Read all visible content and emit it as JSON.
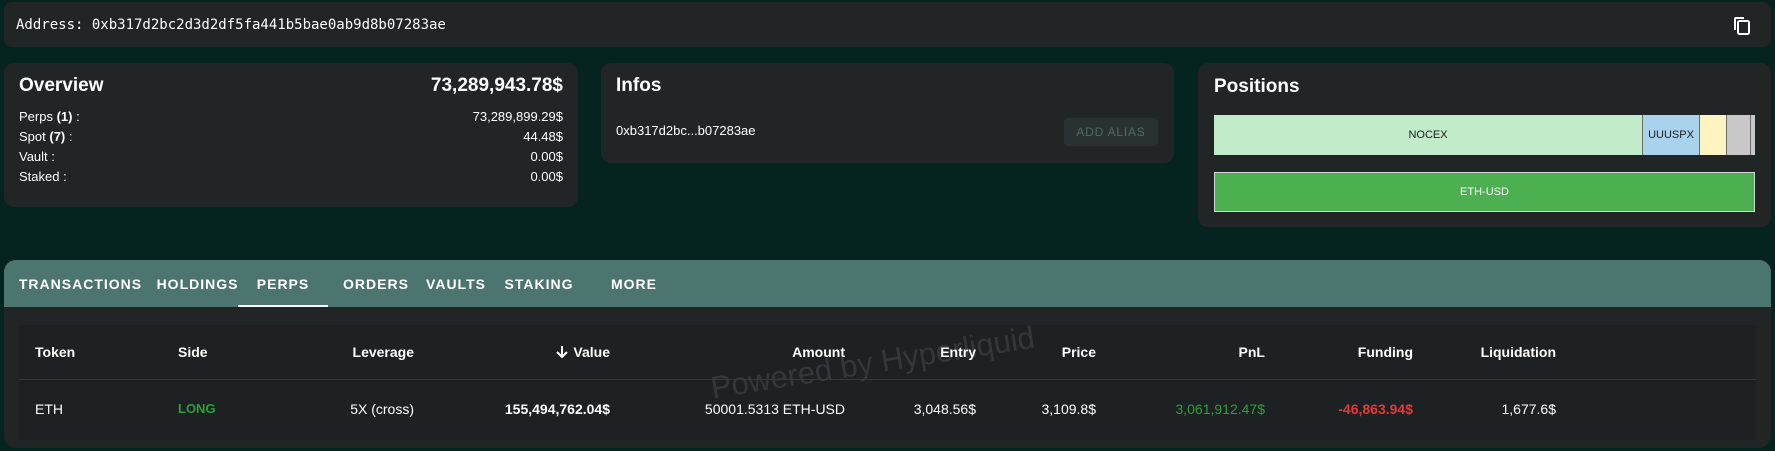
{
  "address_bar": {
    "label": "Address: 0xb317d2bc2d3d2df5fa441b5bae0ab9d8b07283ae",
    "copy_icon": "copy-icon"
  },
  "overview": {
    "title": "Overview",
    "total": "73,289,943.78$",
    "rows": [
      {
        "label": "Perps ",
        "count": "(1)",
        "suffix": " :",
        "value": "73,289,899.29$"
      },
      {
        "label": "Spot ",
        "count": "(7)",
        "suffix": " :",
        "value": "44.48$"
      },
      {
        "label": "Vault :",
        "count": "",
        "suffix": "",
        "value": "0.00$"
      },
      {
        "label": "Staked :",
        "count": "",
        "suffix": "",
        "value": "0.00$"
      }
    ]
  },
  "infos": {
    "title": "Infos",
    "short_address": "0xb317d2bc...b07283ae",
    "add_alias": "ADD ALIAS"
  },
  "positions": {
    "title": "Positions",
    "treemap": [
      {
        "label": "NOCEX",
        "color": "#c1ebc9"
      },
      {
        "label": "UUUSPX",
        "color": "#a9d3ec"
      },
      {
        "label": "",
        "color": "#fff3c2"
      },
      {
        "label": "",
        "color": "#c8c8c8"
      }
    ],
    "perp_label": "ETH-USD",
    "perp_color": "#4caf50"
  },
  "tabs": [
    "TRANSACTIONS",
    "HOLDINGS",
    "PERPS",
    "ORDERS",
    "VAULTS",
    "STAKING",
    "MORE"
  ],
  "active_tab": "PERPS",
  "table": {
    "headers": {
      "token": "Token",
      "side": "Side",
      "leverage": "Leverage",
      "value": "Value",
      "amount": "Amount",
      "entry": "Entry",
      "price": "Price",
      "pnl": "PnL",
      "funding": "Funding",
      "liquidation": "Liquidation"
    },
    "sort_icon": "arrow-down-icon",
    "rows": [
      {
        "token": "ETH",
        "side": "LONG",
        "leverage": "5X (cross)",
        "value": "155,494,762.04$",
        "amount": "50001.5313 ETH-USD",
        "entry": "3,048.56$",
        "price": "3,109.8$",
        "pnl": "3,061,912.47$",
        "funding": "-46,863.94$",
        "liquidation": "1,677.6$"
      }
    ]
  },
  "watermark": "Powered by Hyperliquid",
  "colors": {
    "background": "#05231f",
    "card": "#212526",
    "tabbar": "#4d756f",
    "long": "#2e9e36",
    "negative": "#e53935"
  }
}
